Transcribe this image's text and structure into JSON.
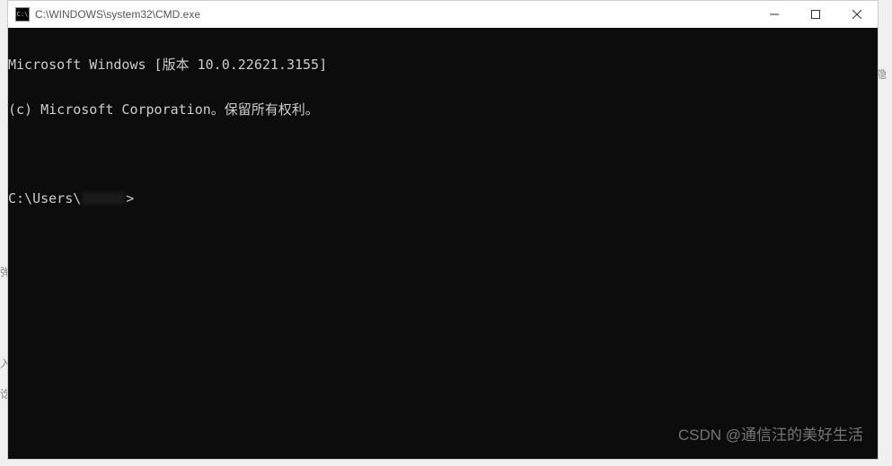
{
  "window": {
    "title": "C:\\WINDOWS\\system32\\CMD.exe",
    "icon_label": "C:\\"
  },
  "terminal": {
    "line1": "Microsoft Windows [版本 10.0.22621.3155]",
    "line2": "(c) Microsoft Corporation。保留所有权利。",
    "prompt_prefix": "C:\\Users\\",
    "prompt_suffix": ">"
  },
  "watermark": "CSDN @通信汪的美好生活",
  "bg": {
    "t1": "弹",
    "t2": "入门",
    "t3": "讫",
    "t4": "隐"
  }
}
